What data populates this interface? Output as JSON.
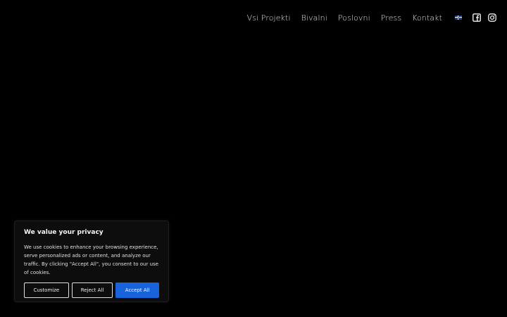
{
  "nav": {
    "links": [
      "Vsi Projekti",
      "Bivalni",
      "Poslovni",
      "Press",
      "Kontakt"
    ],
    "language_flag": "uk-flag-icon",
    "social": [
      "facebook-square-icon",
      "instagram-icon"
    ]
  },
  "cookie_banner": {
    "title": "We value your privacy",
    "text": "We use cookies to enhance your browsing experience, serve personalized ads or content, and analyze our traffic. By clicking \"Accept All\", you consent to our use of cookies.",
    "buttons": {
      "customize": "Customize",
      "reject": "Reject All",
      "accept": "Accept All"
    },
    "accent_color": "#1863dc"
  },
  "colors": {
    "background": "#000000",
    "nav_text": "#e6e6e6"
  }
}
